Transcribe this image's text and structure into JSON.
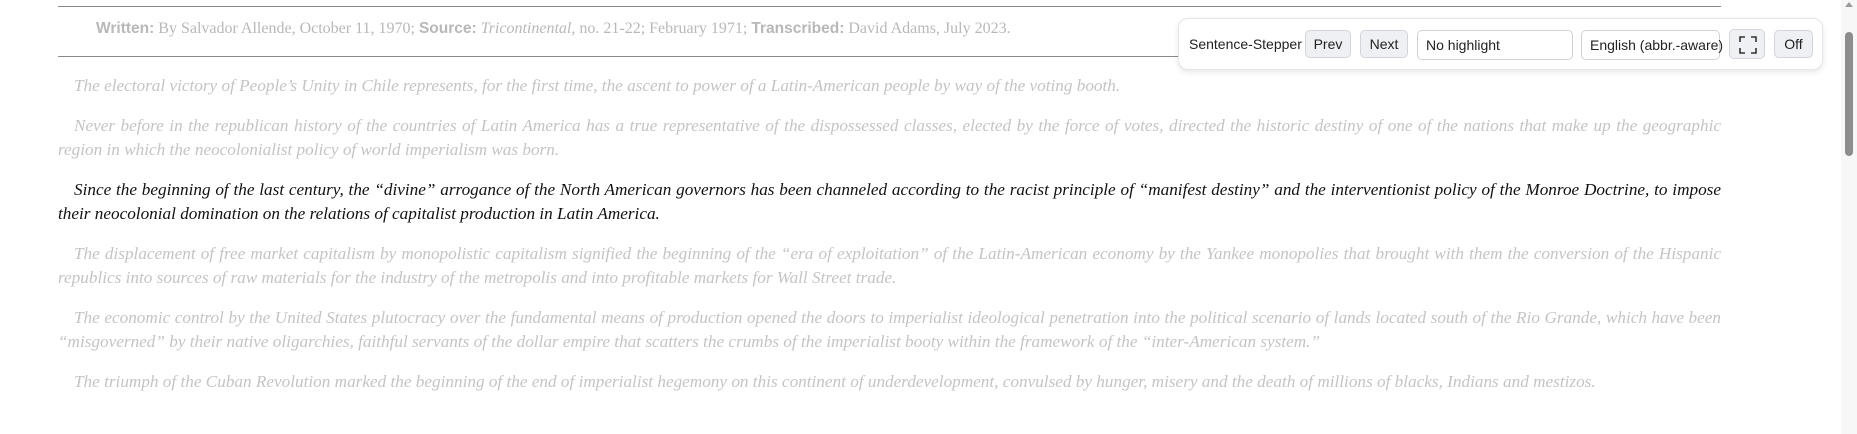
{
  "header": {
    "written_label": "Written:",
    "written_value": " By Salvador Allende, October 11, 1970; ",
    "source_label": "Source:",
    "source_publication": "Tricontinental",
    "source_rest": ", no. 21-22; February 1971; ",
    "transcribed_label": "Transcribed:",
    "transcribed_value": " David Adams, July 2023."
  },
  "paragraphs": [
    "The electoral victory of People’s Unity in Chile represents, for the first time, the ascent to power of a Latin-American people by way of the voting booth.",
    "Never before in the republican history of the countries of Latin America has a true representative of the dispossessed classes, elected by the force of votes, directed the historic destiny of one of the nations that make up the geographic region in which the neocolonialist policy of world imperialism was born.",
    "Since the beginning of the last century, the “divine” arrogance of the North American governors has been channeled according to the racist principle of “manifest destiny” and the interventionist policy of the Monroe Doctrine, to impose their neocolonial domination on the relations of capitalist production in Latin America.",
    "The displacement of free market capitalism by monopolistic capitalism signified the beginning of the “era of exploitation” of the Latin-American economy by the Yankee monopolies that brought with them the conversion of the Hispanic republics into sources of raw materials for the industry of the metropolis and into profitable markets for Wall Street trade.",
    "The economic control by the United States plutocracy over the fundamental means of production opened the doors to imperialist ideological penetration into the political scenario of lands located south of the Rio Grande, which have been “misgoverned” by their native oligarchies, faithful servants of the dollar empire that scatters the crumbs of the imperialist booty within the framework of the “inter-American system.”",
    "The triumph of the Cuban Revolution marked the beginning of the end of imperialist hegemony on this continent of underdevelopment, convulsed by hunger, misery and the death of millions of blacks, Indians and mestizos."
  ],
  "toolbar": {
    "title": "Sentence-Stepper",
    "prev_label": "Prev",
    "next_label": "Next",
    "highlight_selected": "No highlight",
    "language_selected": "English (abbr.-aware)",
    "focus_icon": "focus-frame-icon",
    "off_label": "Off"
  },
  "colors": {
    "active_text": "#111111",
    "dimmed_text": "#c4c4c4",
    "button_bg": "#eef0f3"
  }
}
